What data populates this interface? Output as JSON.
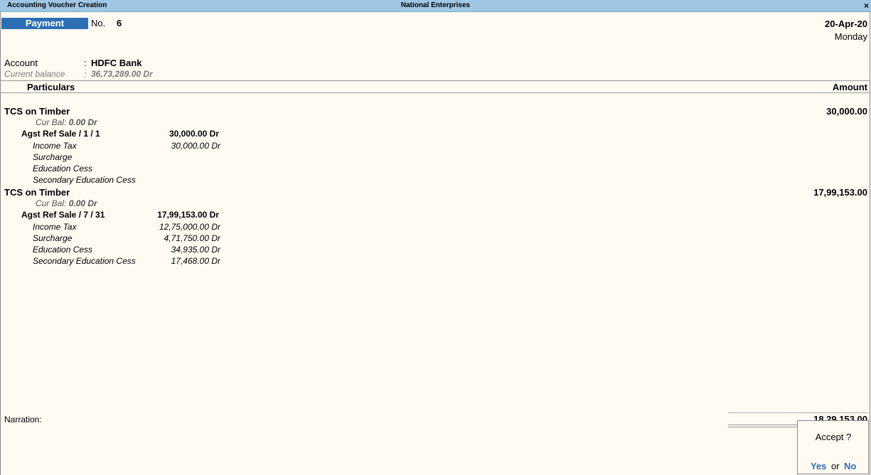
{
  "titlebar": {
    "left": "Accounting Voucher Creation",
    "center": "National Enterprises",
    "close": "×"
  },
  "voucher": {
    "type": "Payment",
    "no_label": "No.",
    "no_value": "6",
    "date": "20-Apr-20",
    "day": "Monday"
  },
  "account": {
    "label": "Account",
    "colon": ":",
    "value": "HDFC Bank",
    "balance_label": "Current balance",
    "balance_colon": ":",
    "balance_value": "36,73,289.00 Dr"
  },
  "columns": {
    "particulars": "Particulars",
    "amount": "Amount"
  },
  "entries": [
    {
      "ledger": "TCS on Timber",
      "amount": "30,000.00",
      "curbal_label": "Cur Bal:",
      "curbal_value": "0.00 Dr",
      "ref_label": "Agst Ref  Sale / 1 / 1",
      "ref_amount": "30,000.00 Dr",
      "taxes": [
        {
          "name": "Income Tax",
          "amount": "30,000.00 Dr"
        },
        {
          "name": "Surcharge",
          "amount": ""
        },
        {
          "name": "Education Cess",
          "amount": ""
        },
        {
          "name": "Secondary Education Cess",
          "amount": ""
        }
      ]
    },
    {
      "ledger": "TCS on Timber",
      "amount": "17,99,153.00",
      "curbal_label": "Cur Bal:",
      "curbal_value": "0.00 Dr",
      "ref_label": "Agst Ref  Sale / 7 / 31",
      "ref_amount": "17,99,153.00 Dr",
      "taxes": [
        {
          "name": "Income Tax",
          "amount": "12,75,000.00 Dr"
        },
        {
          "name": "Surcharge",
          "amount": "4,71,750.00 Dr"
        },
        {
          "name": "Education Cess",
          "amount": "34,935.00 Dr"
        },
        {
          "name": "Secondary Education Cess",
          "amount": "17,468.00 Dr"
        }
      ]
    }
  ],
  "footer": {
    "narration_label": "Narration:",
    "total": "18,29,153.00"
  },
  "accept": {
    "question": "Accept ?",
    "yes": "Yes",
    "or": "or",
    "no": "No"
  },
  "colors": {
    "titlebar": "#9fc6e4",
    "accent": "#2d6fb5",
    "background": "#fffaf2"
  }
}
